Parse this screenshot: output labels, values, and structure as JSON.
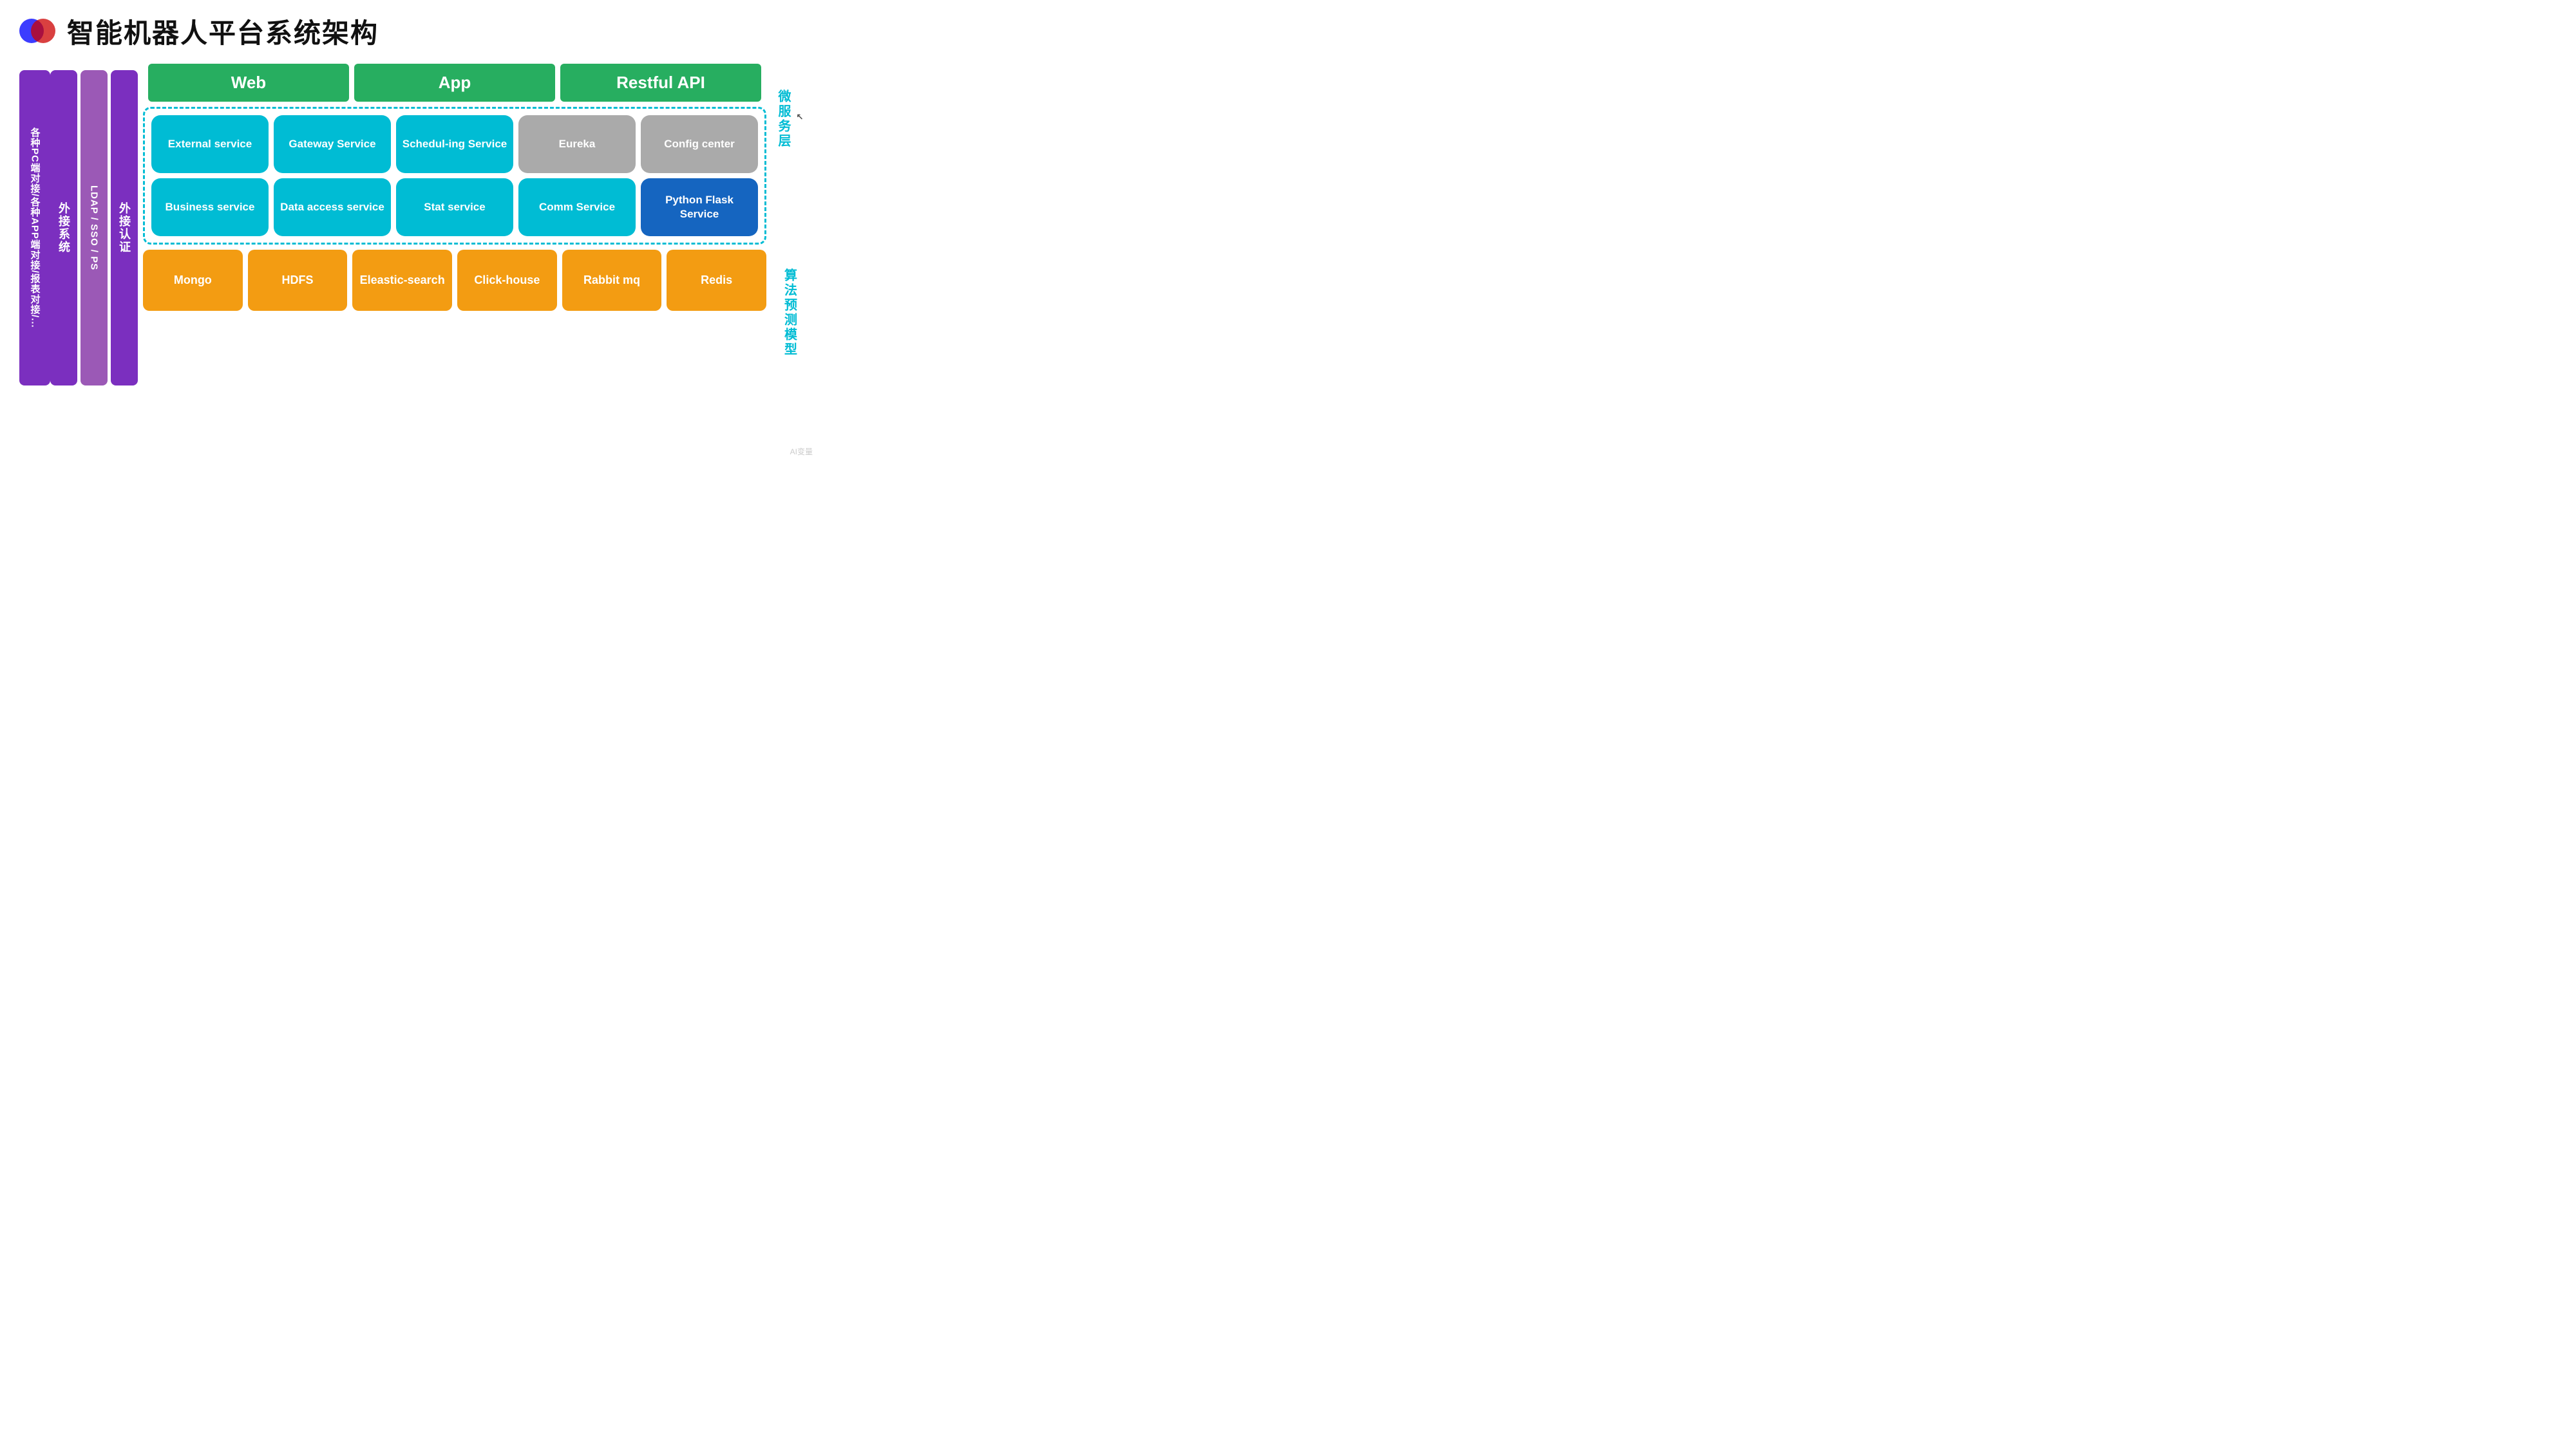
{
  "header": {
    "title": "智能机器人平台系统架构",
    "logo_alt": "AI logo circles"
  },
  "left": {
    "outer_label": "各种PC端对接/各种APP端对接/报表对接/...",
    "middle_label": "LDAP / SSO / PS",
    "inner_label": "外接认证",
    "leftmost_label": "外接系统"
  },
  "top_headers": [
    {
      "label": "Web"
    },
    {
      "label": "App"
    },
    {
      "label": "Restful API"
    }
  ],
  "services_row1": [
    {
      "label": "External service",
      "type": "cyan"
    },
    {
      "label": "Gateway Service",
      "type": "cyan"
    },
    {
      "label": "Schedul-ing Service",
      "type": "cyan"
    },
    {
      "label": "Eureka",
      "type": "gray"
    },
    {
      "label": "Config center",
      "type": "gray"
    }
  ],
  "services_row2": [
    {
      "label": "Business service",
      "type": "cyan"
    },
    {
      "label": "Data access service",
      "type": "cyan"
    },
    {
      "label": "Stat service",
      "type": "cyan"
    },
    {
      "label": "Comm Service",
      "type": "cyan"
    },
    {
      "label": "Python Flask Service",
      "type": "dark-blue"
    }
  ],
  "bottom_cards": [
    {
      "label": "Mongo"
    },
    {
      "label": "HDFS"
    },
    {
      "label": "Eleastic-search"
    },
    {
      "label": "Click-house"
    },
    {
      "label": "Rabbit mq"
    },
    {
      "label": "Redis"
    }
  ],
  "right_labels": [
    {
      "label": "微服务层"
    },
    {
      "label": "算法预测模型"
    }
  ],
  "watermark": "AI变量"
}
